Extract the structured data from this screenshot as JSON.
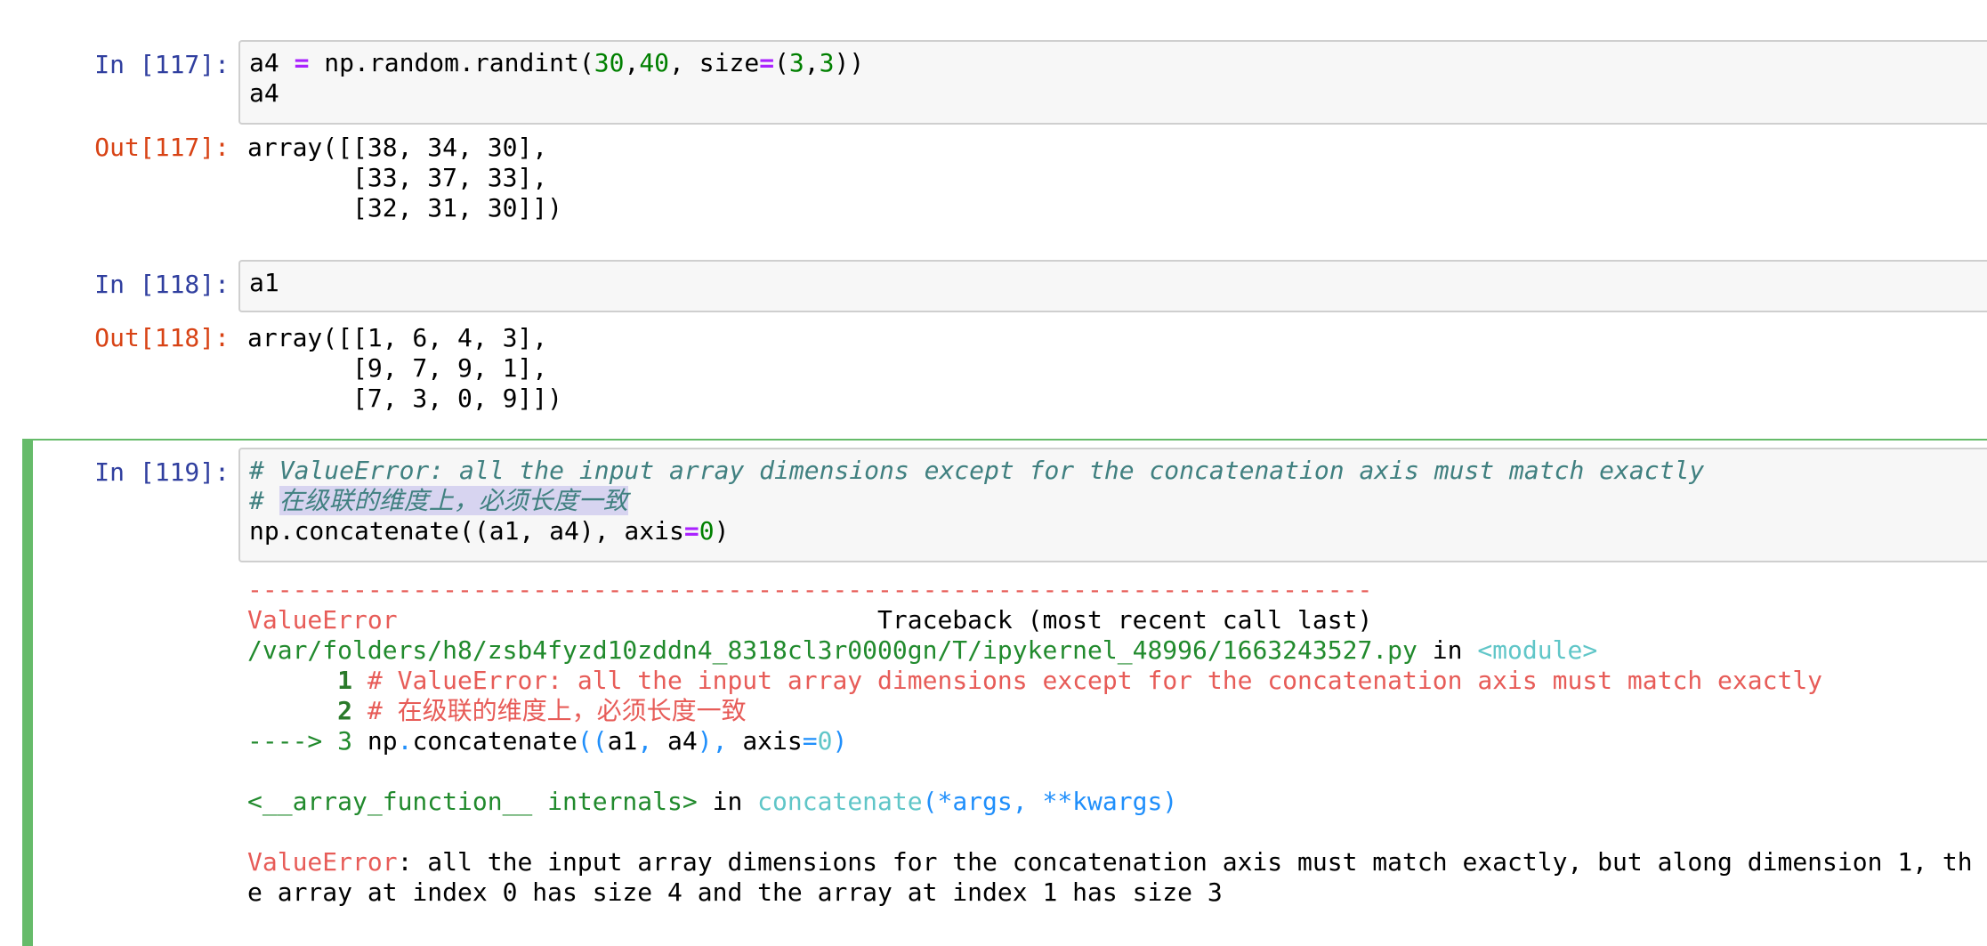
{
  "cells": [
    {
      "in_prompt": "In [117]:",
      "code": {
        "line1": {
          "a": "a4 ",
          "op1": "=",
          "b": " np.random.randint(",
          "n1": "30",
          "c": ",",
          "n2": "40",
          "d": ", size",
          "op2": "=",
          "e": "(",
          "n3": "3",
          "f": ",",
          "n4": "3",
          "g": "))"
        },
        "line2": "a4"
      },
      "out_prompt": "Out[117]:",
      "output": [
        "array([[38, 34, 30],",
        "       [33, 37, 33],",
        "       [32, 31, 30]])"
      ]
    },
    {
      "in_prompt": "In [118]:",
      "code": {
        "line1": "a1"
      },
      "out_prompt": "Out[118]:",
      "output": [
        "array([[1, 6, 4, 3],",
        "       [9, 7, 9, 1],",
        "       [7, 3, 0, 9]])"
      ]
    },
    {
      "in_prompt": "In [119]:",
      "code": {
        "line1": "# ValueError: all the input array dimensions except for the concatenation axis must match exactly",
        "line2_hash": "# ",
        "line2_text": "在级联的维度上，必须长度一致",
        "line3": {
          "a": "np.concatenate((a1, a4), axis",
          "op": "=",
          "n": "0",
          "b": ")"
        }
      },
      "traceback": {
        "rule": "---------------------------------------------------------------------------",
        "error_name": "ValueError",
        "header_right": "Traceback (most recent call last)",
        "file_path": "/var/folders/h8/zsb4fyzd10zddn4_8318cl3r0000gn/T/ipykernel_48996/1663243527.py",
        "in_word": " in ",
        "module": "<module>",
        "line1_num": "1",
        "line1_text": " # ValueError: all the input array dimensions except for the concatenation axis must match exactly",
        "line2_num": "2",
        "line2_text": " # 在级联的维度上，必须长度一致",
        "arrow": "----> 3 ",
        "line3": {
          "a": "np",
          "dot": ".",
          "b": "concatenate",
          "p1": "((",
          "c": "a1",
          "comma": ",",
          "d": " a4",
          "p2": "),",
          "e": " axis",
          "eq": "=",
          "n": "0",
          "p3": ")"
        },
        "internals": "<__array_function__ internals>",
        "in_word2": " in ",
        "func": "concatenate",
        "args": "(*args, **kwargs)",
        "final_error_name": "ValueError",
        "final_msg_1": ": all the input array dimensions for the concatenation axis must match exactly, but along dimension 1, th",
        "final_msg_2": "e array at index 0 has size 4 and the array at index 1 has size 3"
      }
    }
  ],
  "colors": {
    "in_prompt": "#303f9f",
    "out_prompt": "#d84315",
    "selected_cell": "#66bb6a",
    "input_bg": "#f7f7f7"
  }
}
